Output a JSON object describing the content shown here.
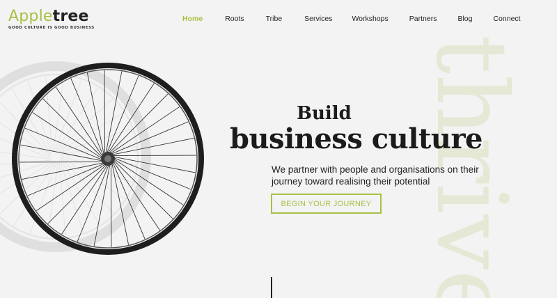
{
  "brand": {
    "name_part1": "Apple",
    "name_part2": "tree",
    "tagline": "GOOD CULTURE IS GOOD BUSINESS"
  },
  "nav": {
    "items": [
      {
        "label": "Home",
        "active": true
      },
      {
        "label": "Roots"
      },
      {
        "label": "Tribe"
      },
      {
        "label": "Services"
      },
      {
        "label": "Workshops"
      },
      {
        "label": "Partners"
      },
      {
        "label": "Blog"
      },
      {
        "label": "Connect"
      }
    ]
  },
  "background": {
    "word": "thrive"
  },
  "hero": {
    "line1": "Build",
    "line2": "business culture",
    "subtitle": "We partner with people and organisations on their journey toward realising their potential",
    "cta_label": "BEGIN YOUR JOURNEY"
  },
  "colors": {
    "accent": "#a6c143",
    "text": "#1b1b1b",
    "background": "#f3f3f3"
  }
}
